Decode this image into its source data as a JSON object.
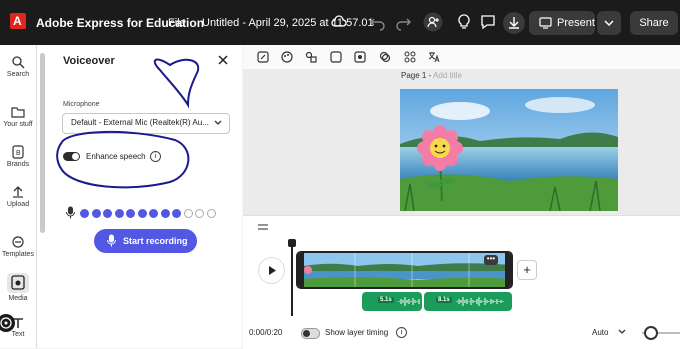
{
  "app": {
    "title": "Adobe Express for Education",
    "file_menu": "File",
    "document_title": "Untitled - April 29, 2025 at 11.57.01",
    "present_label": "Present",
    "share_label": "Share"
  },
  "rail": {
    "items": [
      {
        "label": "Search",
        "icon": "search-icon"
      },
      {
        "label": "Your stuff",
        "icon": "folder-icon"
      },
      {
        "label": "Brands",
        "icon": "brand-icon"
      },
      {
        "label": "Upload",
        "icon": "upload-icon"
      },
      {
        "label": "Templates",
        "icon": "templates-icon"
      },
      {
        "label": "Media",
        "icon": "media-icon"
      },
      {
        "label": "Text",
        "icon": "text-icon"
      }
    ]
  },
  "voiceover": {
    "title": "Voiceover",
    "microphone_label": "Microphone",
    "microphone_value": "Default - External Mic (Realtek(R) Au...",
    "enhance_label": "Enhance speech",
    "enhance_on": true,
    "level_filled": 9,
    "level_total": 12,
    "record_label": "Start recording",
    "accent": "#5258e4"
  },
  "canvas": {
    "page_label": "Page 1 - ",
    "page_title_placeholder": "Add title"
  },
  "timeline": {
    "current_time": "0:00/0:20",
    "show_layer_timing": "Show layer timing",
    "audio_clips": [
      {
        "label": "5.1s"
      },
      {
        "label": "8.1s"
      }
    ],
    "zoom_label": "Auto",
    "audio_color": "#1c9c5a"
  }
}
